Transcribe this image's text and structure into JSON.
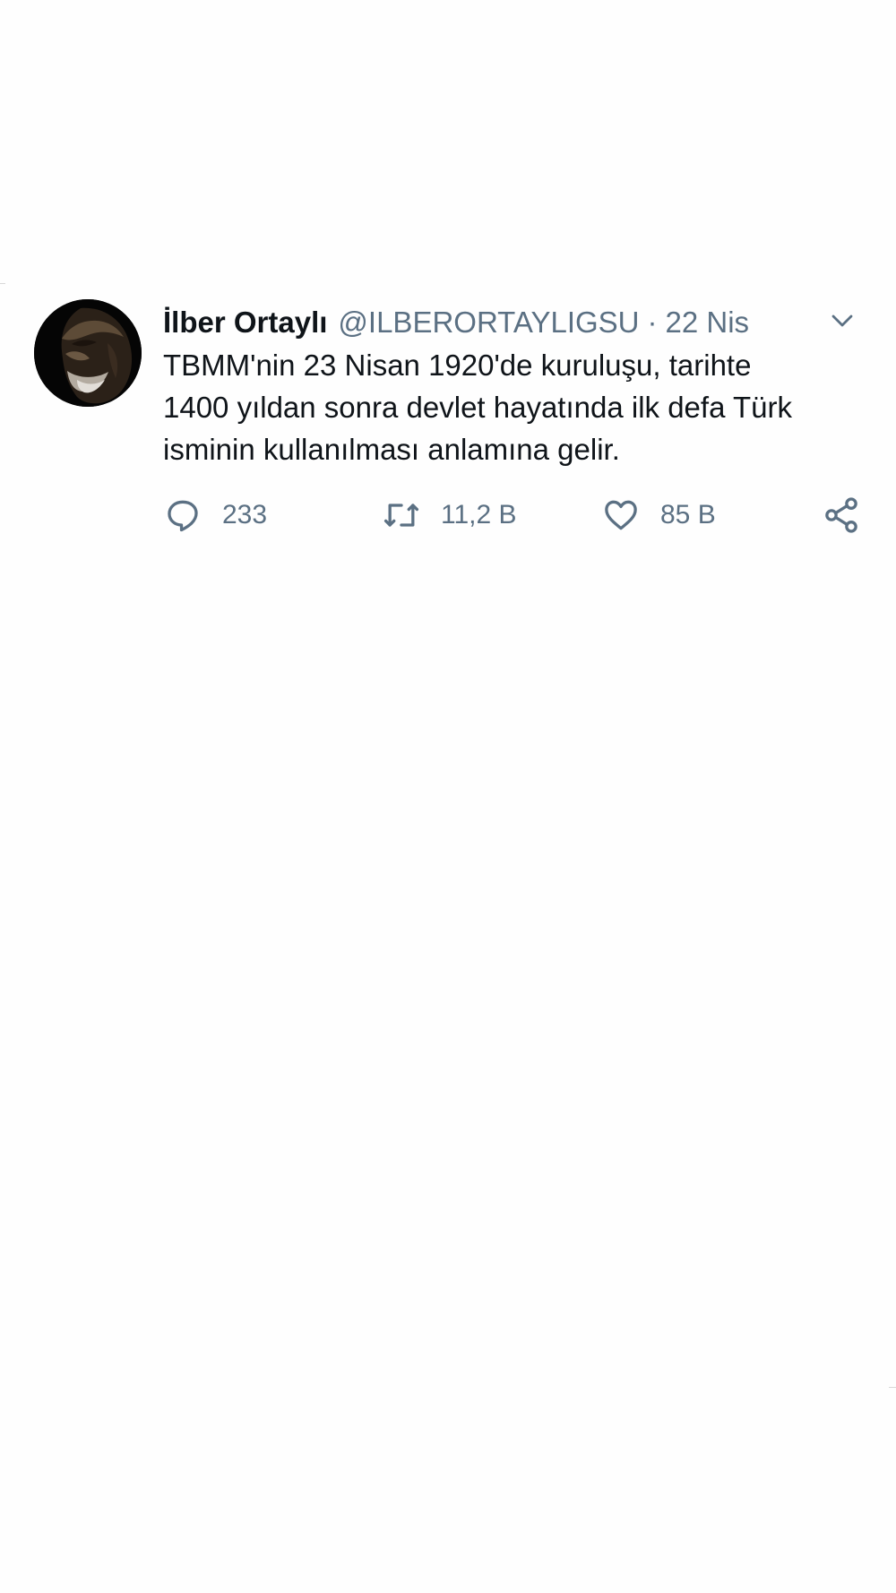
{
  "tweet": {
    "display_name": "İlber Ortaylı",
    "handle": "@ILBERORTAYLIGSU",
    "separator": "·",
    "date": "22 Nis",
    "text": "TBMM'nin 23 Nisan 1920'de kuruluşu, tarihte\n1400 yıldan sonra devlet hayatında ilk defa Türk\nisminin kullanılması anlamına gelir.",
    "avatar_icon": "profile-photo",
    "menu_icon": "chevron-down-icon"
  },
  "actions": {
    "reply": {
      "icon": "reply-icon",
      "count": "233"
    },
    "retweet": {
      "icon": "retweet-icon",
      "count": "11,2 B"
    },
    "like": {
      "icon": "heart-icon",
      "count": "85 B"
    },
    "share": {
      "icon": "share-icon"
    }
  },
  "colors": {
    "background": "#ffffff",
    "text": "#0f1419",
    "secondary": "#5b7083"
  }
}
